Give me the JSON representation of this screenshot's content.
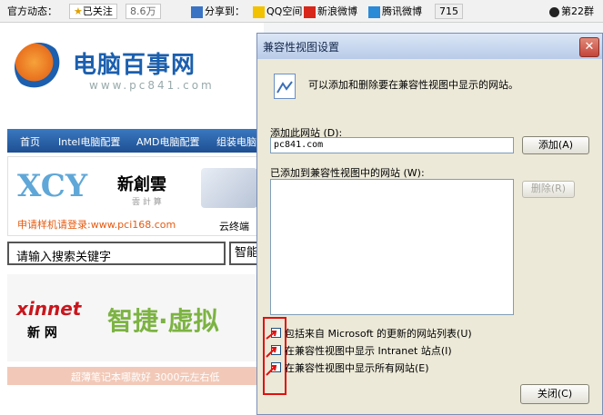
{
  "topbar": {
    "official_label": "官方动态：",
    "follow_label": "已关注",
    "follow_count": "8.6万",
    "share_label": "分享到：",
    "qq_label": "QQ空间",
    "sina_label": "新浪微博",
    "tencent_label": "腾讯微博",
    "tencent_count": "715",
    "rank_label": "第22群"
  },
  "site": {
    "logo_text": "电脑百事网",
    "logo_url": "www.pc841.com",
    "nav": [
      "首页",
      "Intel电脑配置",
      "AMD电脑配置",
      "组装电脑"
    ],
    "banner1_brand": "新創雲",
    "banner1_sub": "雲 計 算",
    "banner1_apply": "申请样机请登录:www.pci168.com",
    "banner1_side": "云终端",
    "search_placeholder": "请输入搜索关键字",
    "search_button": "智能",
    "banner2_brand": "xinnet",
    "banner2_cn": "新 网",
    "banner2_slogan": "智捷·虚拟",
    "banner3_text": "超薄笔记本哪款好 3000元左右低"
  },
  "dialog": {
    "title": "兼容性视图设置",
    "description": "可以添加和删除要在兼容性视图中显示的网站。",
    "add_label": "添加此网站 (D):",
    "add_value": "pc841.com",
    "add_button": "添加(A)",
    "list_label": "已添加到兼容性视图中的网站 (W):",
    "remove_button": "删除(R)",
    "options": [
      "包括来自 Microsoft 的更新的网站列表(U)",
      "在兼容性视图中显示 Intranet 站点(I)",
      "在兼容性视图中显示所有网站(E)"
    ],
    "close_button": "关闭(C)",
    "colors": {
      "accent": "#1b5fae",
      "highlight": "#e01010"
    }
  }
}
